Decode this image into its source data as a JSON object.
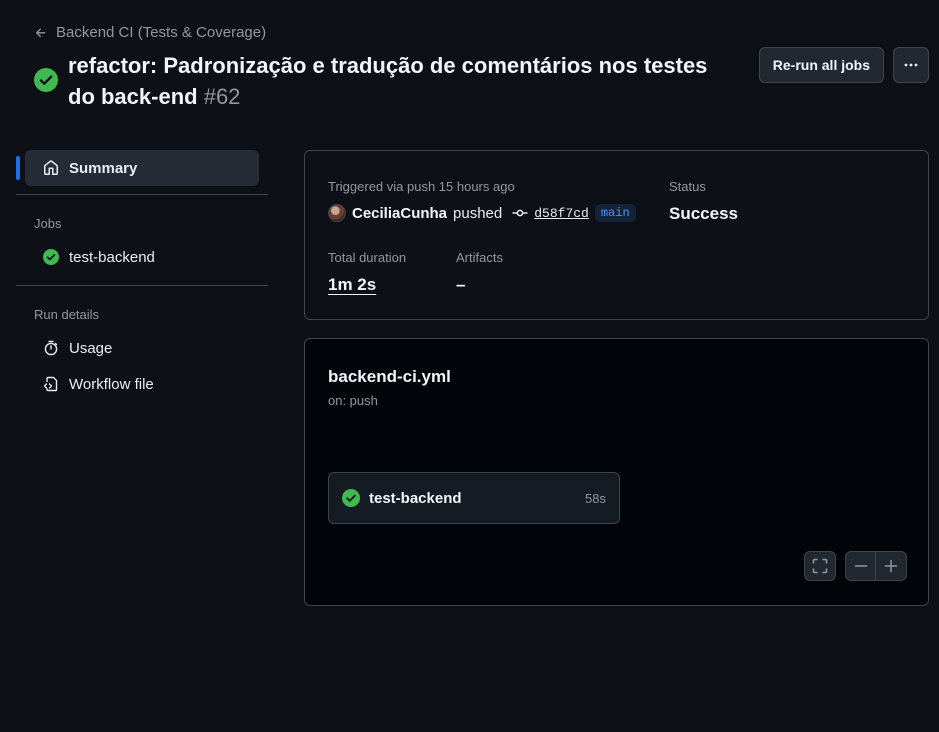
{
  "header": {
    "back_label": "Backend CI (Tests & Coverage)",
    "title": "refactor: Padronização e tradução de comentários nos testes do back-end",
    "run_number": "#62",
    "rerun_label": "Re-run all jobs",
    "more_icon": "kebab-horizontal-icon"
  },
  "sidebar": {
    "summary_label": "Summary",
    "jobs_heading": "Jobs",
    "jobs": [
      {
        "label": "test-backend",
        "status": "success"
      }
    ],
    "run_details_heading": "Run details",
    "usage_label": "Usage",
    "workflow_file_label": "Workflow file"
  },
  "summary": {
    "trigger_label": "Triggered via push 15 hours ago",
    "author": "CeciliaCunha",
    "action": "pushed",
    "commit_sha": "d58f7cd",
    "branch": "main",
    "status_label": "Status",
    "status_value": "Success",
    "duration_label": "Total duration",
    "duration_value": "1m 2s",
    "artifacts_label": "Artifacts",
    "artifacts_value": "–"
  },
  "graph": {
    "workflow_name": "backend-ci.yml",
    "trigger": "on: push",
    "job_name": "test-backend",
    "job_duration": "58s"
  },
  "colors": {
    "background": "#0d1117",
    "success": "#3fb950",
    "accent": "#1f6feb",
    "border": "#3d444d"
  }
}
